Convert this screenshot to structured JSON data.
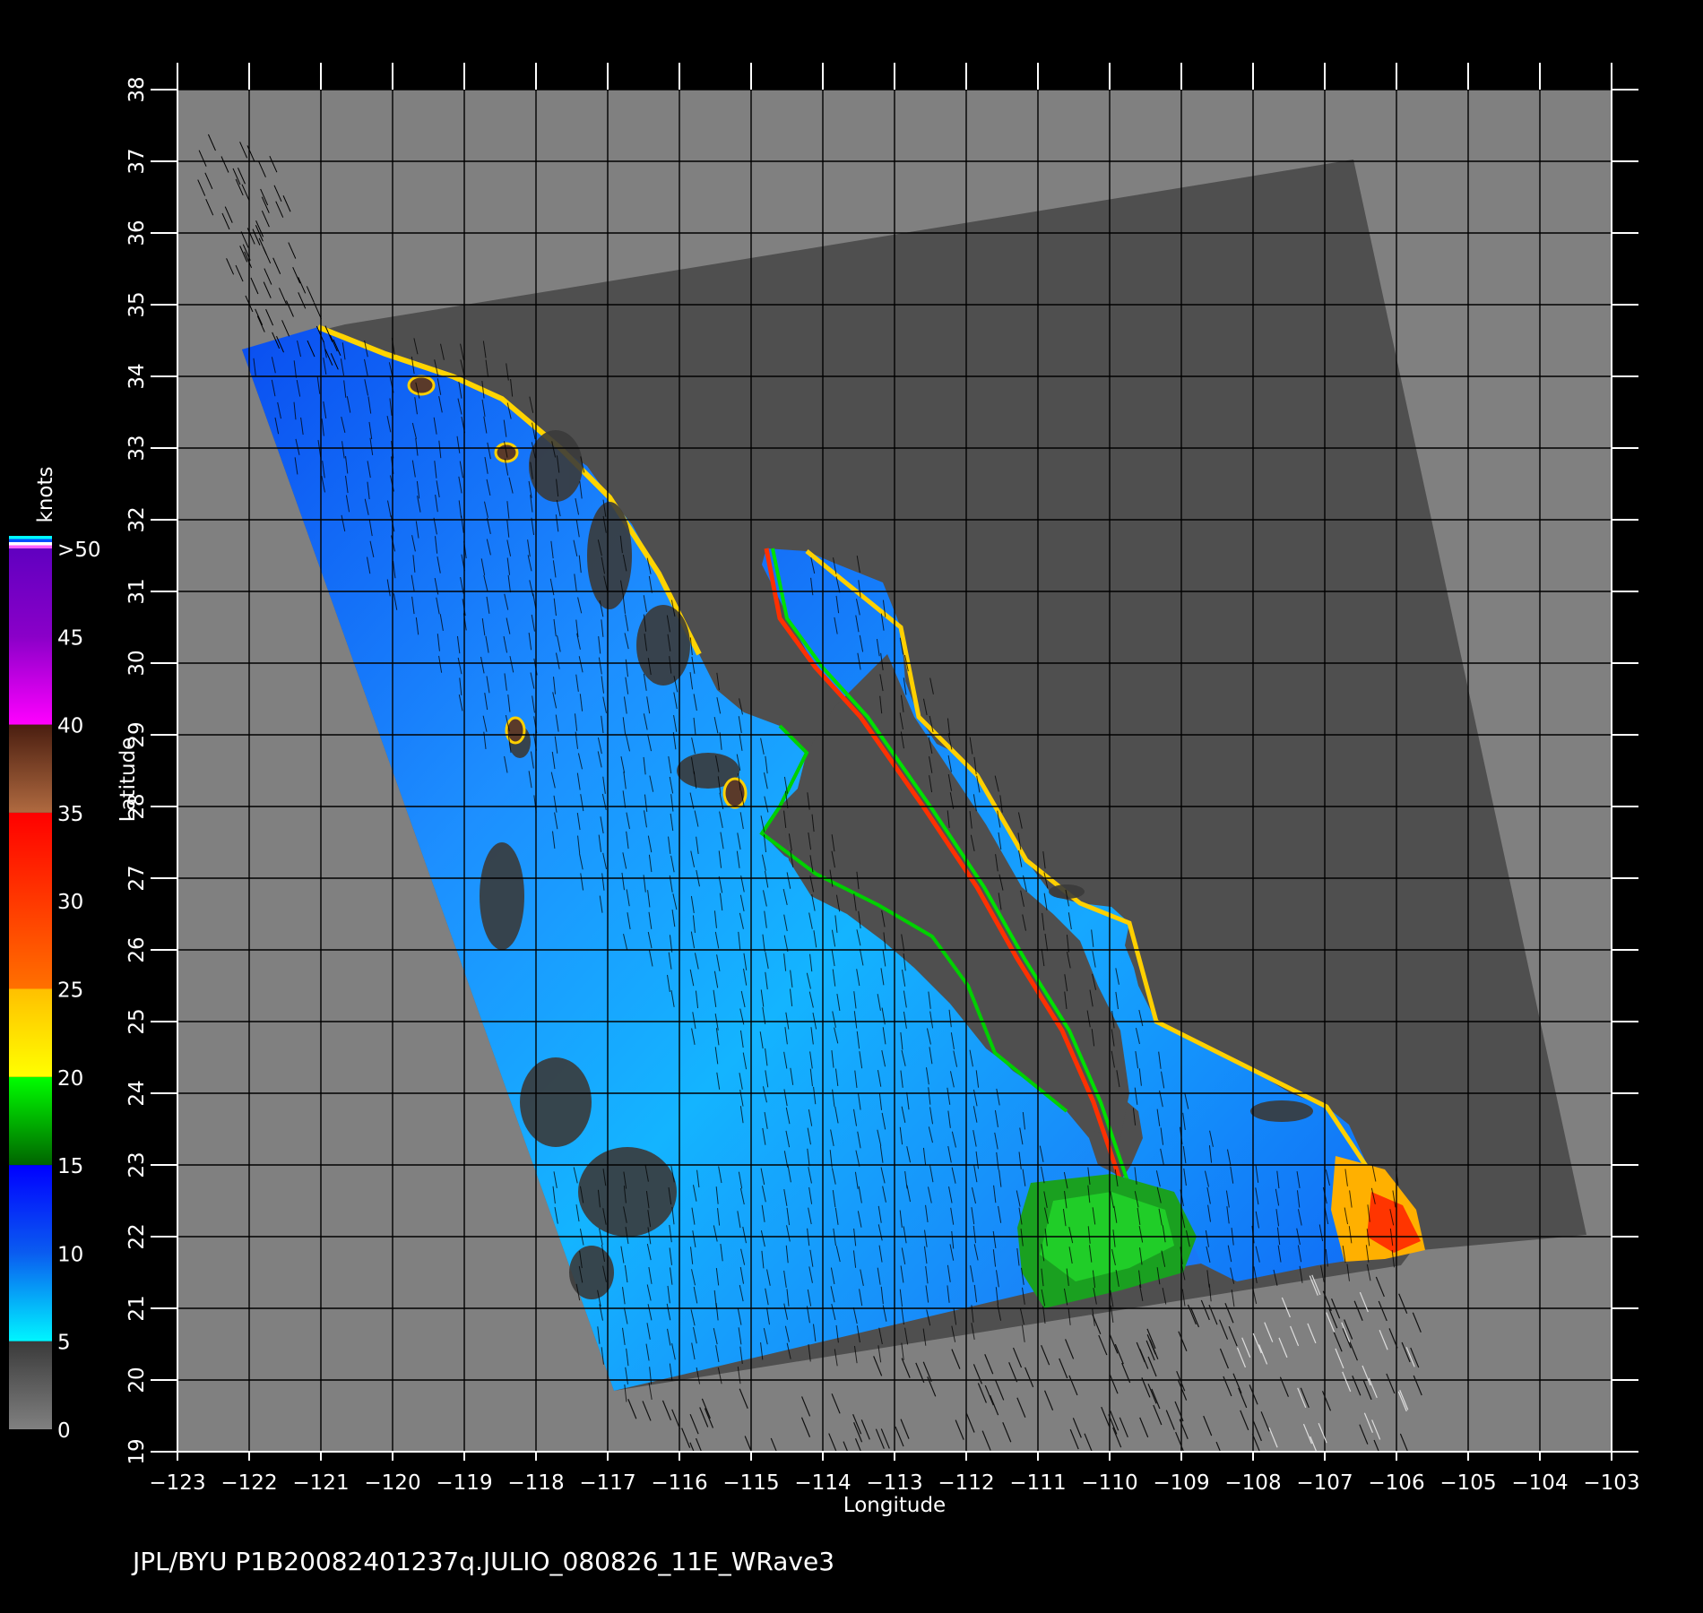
{
  "map": {
    "xlabel": "Longitude",
    "ylabel": "Latitude",
    "x_range": [
      -123,
      -103
    ],
    "y_range": [
      19,
      38
    ],
    "x_ticks": [
      "−123",
      "−122",
      "−121",
      "−120",
      "−119",
      "−118",
      "−117",
      "−116",
      "−115",
      "−114",
      "−113",
      "−112",
      "−111",
      "−110",
      "−109",
      "−108",
      "−107",
      "−106",
      "−105",
      "−104",
      "−103"
    ],
    "y_ticks": [
      "19",
      "20",
      "21",
      "22",
      "23",
      "24",
      "25",
      "26",
      "27",
      "28",
      "29",
      "30",
      "31",
      "32",
      "33",
      "34",
      "35",
      "36",
      "37",
      "38"
    ],
    "grid": true,
    "background_gray": "#808080",
    "swath_dark_gray": "#4f4f4f",
    "land_color": "#4f4f4f"
  },
  "colorbar": {
    "unit": "knots",
    "labels": [
      "0",
      "5",
      "10",
      "15",
      "20",
      "25",
      "30",
      "35",
      "40",
      "45",
      ">50"
    ],
    "bands": [
      {
        "from": 0,
        "to": 5,
        "colors": [
          "#808080",
          "#3a3a3a"
        ]
      },
      {
        "from": 5,
        "to": 15,
        "colors": [
          "#00f5ff",
          "#0a5cf0",
          "#0000ff"
        ]
      },
      {
        "from": 15,
        "to": 20,
        "colors": [
          "#006400",
          "#00ff00"
        ]
      },
      {
        "from": 20,
        "to": 25,
        "colors": [
          "#ffff00",
          "#ffc000"
        ]
      },
      {
        "from": 25,
        "to": 35,
        "colors": [
          "#ff7000",
          "#ff0000"
        ]
      },
      {
        "from": 35,
        "to": 40,
        "colors": [
          "#b06a40",
          "#4a1e10"
        ]
      },
      {
        "from": 40,
        "to": 50,
        "colors": [
          "#ff00ff",
          "#8a00c8",
          "#6000c0"
        ]
      }
    ]
  },
  "footer": {
    "text": "JPL/BYU  P1B20082401237q.JULIO_080826_11E_WRave3"
  }
}
